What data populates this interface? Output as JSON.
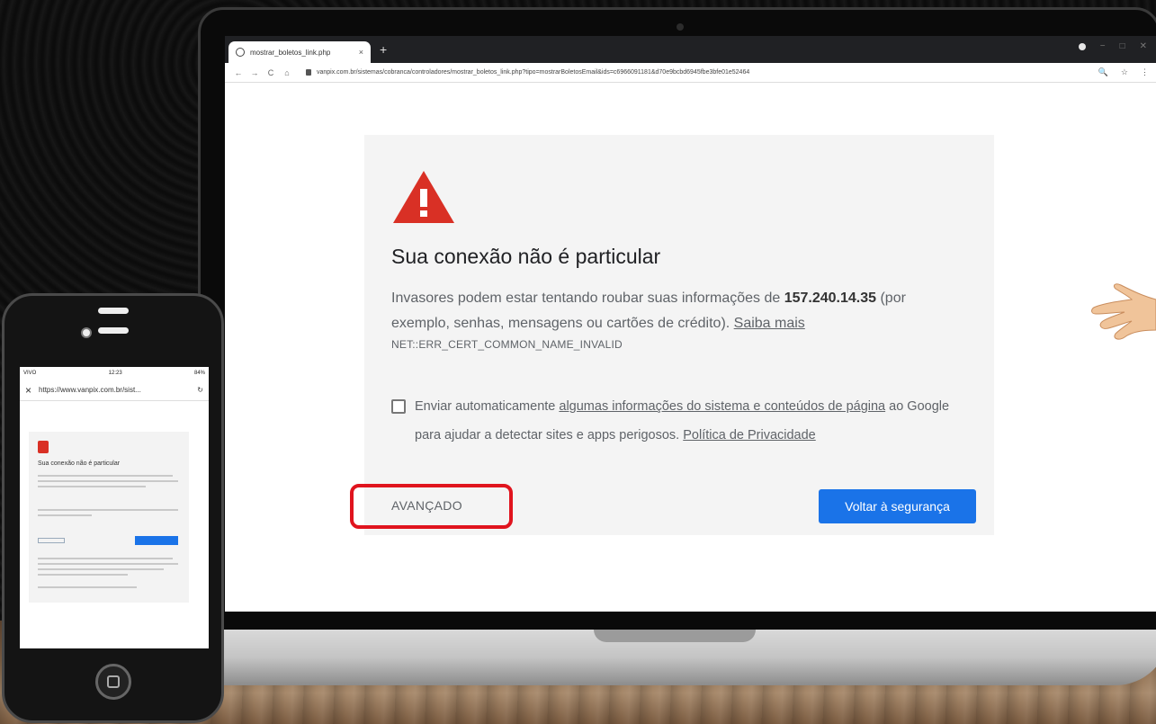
{
  "browser": {
    "tab_title": "mostrar_boletos_link.php",
    "tab_close": "×",
    "new_tab": "+",
    "url": "vanpix.com.br/sistemas/cobranca/controladores/mostrar_boletos_link.php?tipo=mostrarBoletosEmail&ids=c6966091181&d70e9bcbd6945fbe3bfe01e52464",
    "back": "←",
    "forward": "→",
    "reload": "C",
    "home": "⌂",
    "zoom_icon": "🔍",
    "star_icon": "☆",
    "menu_icon": "⋮",
    "minimize": "−",
    "maximize": "□",
    "close": "✕"
  },
  "interstitial": {
    "title": "Sua conexão não é particular",
    "desc_part1": "Invasores podem estar tentando roubar suas informações de ",
    "host": "157.240.14.35",
    "desc_part2": " (por exemplo, senhas, mensagens ou cartões de crédito). ",
    "learn_more": "Saiba mais",
    "error_code": "NET::ERR_CERT_COMMON_NAME_INVALID",
    "optin_part1": "Enviar automaticamente ",
    "optin_link": "algumas informações do sistema e conteúdos de página",
    "optin_part2": " ao Google para ajudar a detectar sites e apps perigosos. ",
    "privacy_link": "Política de Privacidade",
    "advanced_label": "AVANÇADO",
    "back_label": "Voltar à segurança"
  },
  "phone": {
    "carrier": "VIVO",
    "time": "12:23",
    "battery": "84%",
    "close": "×",
    "url": "https://www.vanpix.com.br/sist...",
    "reload": "↻",
    "title": "Sua conexão não é particular"
  },
  "colors": {
    "warning_red": "#d93025",
    "button_blue": "#1a73e8",
    "highlight_red": "#e0141e"
  }
}
